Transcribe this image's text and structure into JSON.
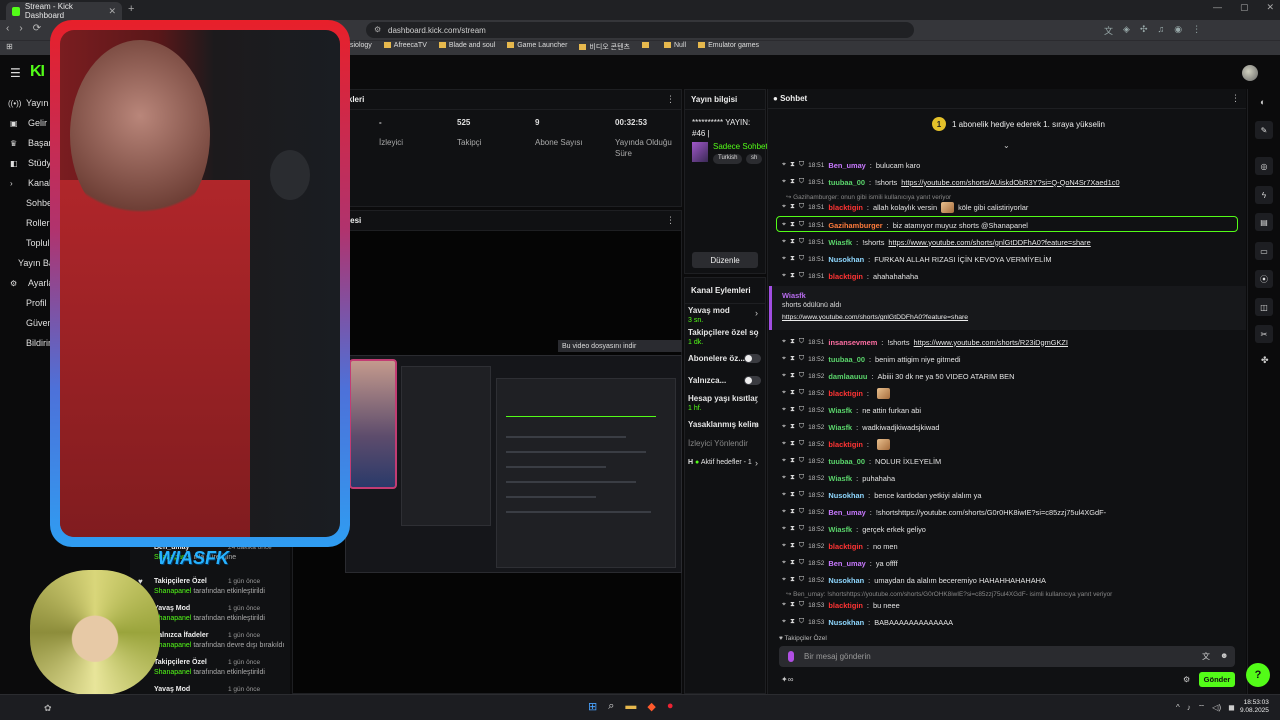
{
  "browser": {
    "tab_title": "Stream - Kick Dashboard",
    "url": "dashboard.kick.com/stream",
    "bookmarks": [
      "AfreecaTV",
      "Blade and soul",
      "Game Launcher",
      "비디오 콘텐츠",
      "",
      "Null",
      "Emulator games"
    ],
    "bookmark_cut": "siology"
  },
  "brand": {
    "logo": "KI",
    "accent": "#53fc18"
  },
  "sidebar": {
    "items": [
      "Yayın",
      "Gelir",
      "Başarı",
      "Stüdyo",
      "Kanal",
      "Sohbe",
      "Roller",
      "Toplul",
      "Yayın Ba",
      "Ayarla",
      "Profil",
      "Güven",
      "Bildirim"
    ]
  },
  "stats": {
    "title": "tikleri",
    "items": [
      {
        "value": "-",
        "label": "İzleyici"
      },
      {
        "value": "525",
        "label": "Takipçi"
      },
      {
        "value": "9",
        "label": "Abone Sayısı"
      },
      {
        "value": "00:32:53",
        "label": "Yayında Olduğu Süre"
      }
    ]
  },
  "preview": {
    "title": "mesi",
    "download_bar": "Bu video dosyasını indir"
  },
  "stream_info": {
    "title": "Yayın bilgisi",
    "stream_title": "********** YAYIN: #46 |",
    "category": "Sadece Sohbet",
    "tags": [
      "Turkish",
      "sh"
    ],
    "edit_label": "Düzenle"
  },
  "channel_actions": {
    "title": "Kanal Eylemleri",
    "items": [
      {
        "label": "Yavaş mod",
        "sub": "3 sn."
      },
      {
        "label": "Takipçilere özel so",
        "sub": "1 dk."
      },
      {
        "label": "Abonelere öz...",
        "sub": ""
      },
      {
        "label": "Yalnızca...",
        "sub": ""
      },
      {
        "label": "Hesap yaşı kısıtlar",
        "sub": "1 hf."
      },
      {
        "label": "Yasaklanmış kelim",
        "sub": ""
      },
      {
        "label": "İzleyici Yönlendir",
        "sub": ""
      },
      {
        "label": "Aktif hedefler - 1",
        "sub": ""
      }
    ]
  },
  "activity": {
    "items": [
      {
        "title": "Ben_umay",
        "sub": "Shanapanel",
        "sub2": "ıkla süreliğine",
        "time": "24 dakika önce"
      },
      {
        "title": "Takipçilere Özel",
        "sub": "Shanapanel",
        "sub2": "tarafından etkinleştirildi",
        "time": "1 gün önce"
      },
      {
        "title": "Yavaş Mod",
        "sub": "Shanapanel",
        "sub2": "tarafından etkinleştirildi",
        "time": "1 gün önce"
      },
      {
        "title": "Yalnızca İfadeler",
        "sub": "Shanapanel",
        "sub2": "tarafından devre dışı bırakıldı",
        "time": "1 gün önce"
      },
      {
        "title": "Takipçilere Özel",
        "sub": "Shanapanel",
        "sub2": "tarafından etkinleştirildi",
        "time": "1 gün önce"
      },
      {
        "title": "Yavaş Mod",
        "sub": "",
        "sub2": "",
        "time": "1 gün önce"
      }
    ]
  },
  "overlay_name": "WIASFK",
  "chat": {
    "title": "Sohbet",
    "goal": "1 abonelik hediye ederek 1. sıraya yükselin",
    "goal_badge": "1",
    "messages": [
      {
        "time": "18:51",
        "user": "Ben_umay",
        "color": "#c879ff",
        "text": "bulucam karo",
        "link": ""
      },
      {
        "time": "18:51",
        "user": "tuubaa_00",
        "color": "#5ad46b",
        "text": "!shorts ",
        "link": "https://youtube.com/shorts/AUiskdObR3Y?si=Q-QoN4Sr7Xaed1c0"
      },
      {
        "time": "18:51",
        "user": "blacktigin",
        "color": "#ff3434",
        "text": "allah kolaylık versin",
        "link": "",
        "after": " köle gibi calistiriyorlar"
      },
      {
        "time": "18:51",
        "user": "Gazihamburger",
        "color": "#ff7b3c",
        "text": "biz atamıyor muyuz shorts @Shanapanel",
        "link": ""
      },
      {
        "time": "18:51",
        "user": "Wiasfk",
        "color": "#5ad46b",
        "text": "!shorts ",
        "link": "https://www.youtube.com/shorts/gnlGtDDFhA0?feature=share"
      },
      {
        "time": "18:51",
        "user": "Nusokhan",
        "color": "#8fd8ff",
        "text": "FURKAN ALLAH RIZASI İÇİN KEVOYA VERMİYELİM",
        "link": ""
      },
      {
        "time": "18:51",
        "user": "blacktigin",
        "color": "#ff3434",
        "text": "ahahahahaha",
        "link": ""
      },
      {
        "time": "18:51",
        "user": "insansevmem",
        "color": "#ff6ea2",
        "text": "!shorts ",
        "link": "https://www.youtube.com/shorts/R23iDgmGKZI"
      },
      {
        "time": "18:52",
        "user": "tuubaa_00",
        "color": "#5ad46b",
        "text": "benim attigim niye gitmedi",
        "link": ""
      },
      {
        "time": "18:52",
        "user": "damlaauuu",
        "color": "#5ad46b",
        "text": "Abiiii 30 dk ne ya 50 VIDEO ATARIM BEN",
        "link": ""
      },
      {
        "time": "18:52",
        "user": "blacktigin",
        "color": "#ff3434",
        "text": "",
        "link": "",
        "emote": true
      },
      {
        "time": "18:52",
        "user": "Wiasfk",
        "color": "#5ad46b",
        "text": "ne attin furkan abi",
        "link": ""
      },
      {
        "time": "18:52",
        "user": "Wiasfk",
        "color": "#5ad46b",
        "text": "wadkiwadjkiwadsjkiwad",
        "link": ""
      },
      {
        "time": "18:52",
        "user": "blacktigin",
        "color": "#ff3434",
        "text": "",
        "link": "",
        "emote": true
      },
      {
        "time": "18:52",
        "user": "tuubaa_00",
        "color": "#5ad46b",
        "text": "NOLUR İXLEYELİM",
        "link": ""
      },
      {
        "time": "18:52",
        "user": "Wiasfk",
        "color": "#5ad46b",
        "text": "puhahaha",
        "link": ""
      },
      {
        "time": "18:52",
        "user": "Nusokhan",
        "color": "#8fd8ff",
        "text": "bence kardodan yetkiyi alalım ya",
        "link": ""
      },
      {
        "time": "18:52",
        "user": "Ben_umay",
        "color": "#c879ff",
        "text": "!shortshttps://youtube.com/shorts/G0r0HK8iwIE?si=c85zzj75ul4XGdF-",
        "link": ""
      },
      {
        "time": "18:52",
        "user": "Wiasfk",
        "color": "#5ad46b",
        "text": "gerçek erkek geliyo",
        "link": ""
      },
      {
        "time": "18:52",
        "user": "blacktigin",
        "color": "#ff3434",
        "text": "no men",
        "link": ""
      },
      {
        "time": "18:52",
        "user": "Ben_umay",
        "color": "#c879ff",
        "text": "ya offff",
        "link": ""
      },
      {
        "time": "18:52",
        "user": "Nusokhan",
        "color": "#8fd8ff",
        "text": "umaydan da alalım beceremiyo HAHAHHAHAHAHA",
        "link": ""
      },
      {
        "time": "18:53",
        "user": "blacktigin",
        "color": "#ff3434",
        "text": "bu neee",
        "link": ""
      },
      {
        "time": "18:53",
        "user": "Nusokhan",
        "color": "#8fd8ff",
        "text": "BABAAAAAAAAAAAAA",
        "link": ""
      }
    ],
    "reply1": "↪ Gazihamburger: onun gibi ismili kullanıcıya yanıt veriyor",
    "reply2": "↪ Ben_umay: !shortshttps://youtube.com/shorts/G0rOHK8iwIE?si=c85zzj75ul4XGdF-  isimli kullanıcıya yanıt veriyor",
    "redeem": {
      "user": "Wiasfk",
      "title": "shorts ödülünü aldı",
      "link": "https://www.youtube.com/shorts/gnlGtDDFhA0?feature=share"
    },
    "follow_note": "♥ Takipçiler Özel",
    "input_placeholder": "Bir mesaj gönderin",
    "send": "Gönder"
  },
  "taskbar": {
    "time": "18:53:03",
    "date": "9.08.2025"
  }
}
